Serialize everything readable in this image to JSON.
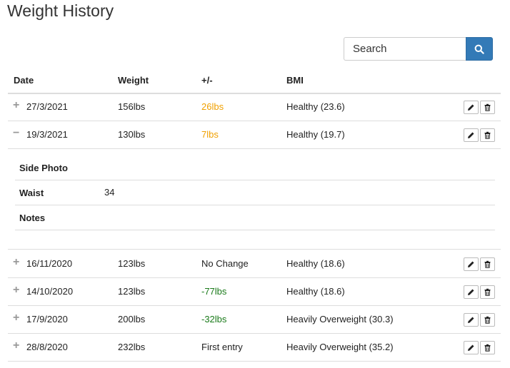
{
  "title": "Weight History",
  "search": {
    "placeholder": "Search"
  },
  "table": {
    "headers": [
      "Date",
      "Weight",
      "+/-",
      "BMI"
    ],
    "rows": [
      {
        "toggle": "+",
        "date": "27/3/2021",
        "weight": "156lbs",
        "change": "26lbs",
        "change_color": "#f0a000",
        "bmi": "Healthy (23.6)"
      },
      {
        "toggle": "−",
        "date": "19/3/2021",
        "weight": "130lbs",
        "change": "7lbs",
        "change_color": "#f0a000",
        "bmi": "Healthy (19.7)"
      },
      {
        "toggle": "+",
        "date": "16/11/2020",
        "weight": "123lbs",
        "change": "No Change",
        "change_color": "#222222",
        "bmi": "Healthy (18.6)"
      },
      {
        "toggle": "+",
        "date": "14/10/2020",
        "weight": "123lbs",
        "change": "-77lbs",
        "change_color": "#1a7a1a",
        "bmi": "Healthy (18.6)"
      },
      {
        "toggle": "+",
        "date": "17/9/2020",
        "weight": "200lbs",
        "change": "-32lbs",
        "change_color": "#1a7a1a",
        "bmi": "Heavily Overweight (30.3)"
      },
      {
        "toggle": "+",
        "date": "28/8/2020",
        "weight": "232lbs",
        "change": "First entry",
        "change_color": "#222222",
        "bmi": "Heavily Overweight (35.2)"
      }
    ]
  },
  "details": {
    "side_photo_label": "Side Photo",
    "waist_label": "Waist",
    "waist_value": "34",
    "notes_label": "Notes"
  },
  "icons": {
    "search": "search-icon",
    "edit": "pencil-icon",
    "delete": "trash-icon"
  }
}
